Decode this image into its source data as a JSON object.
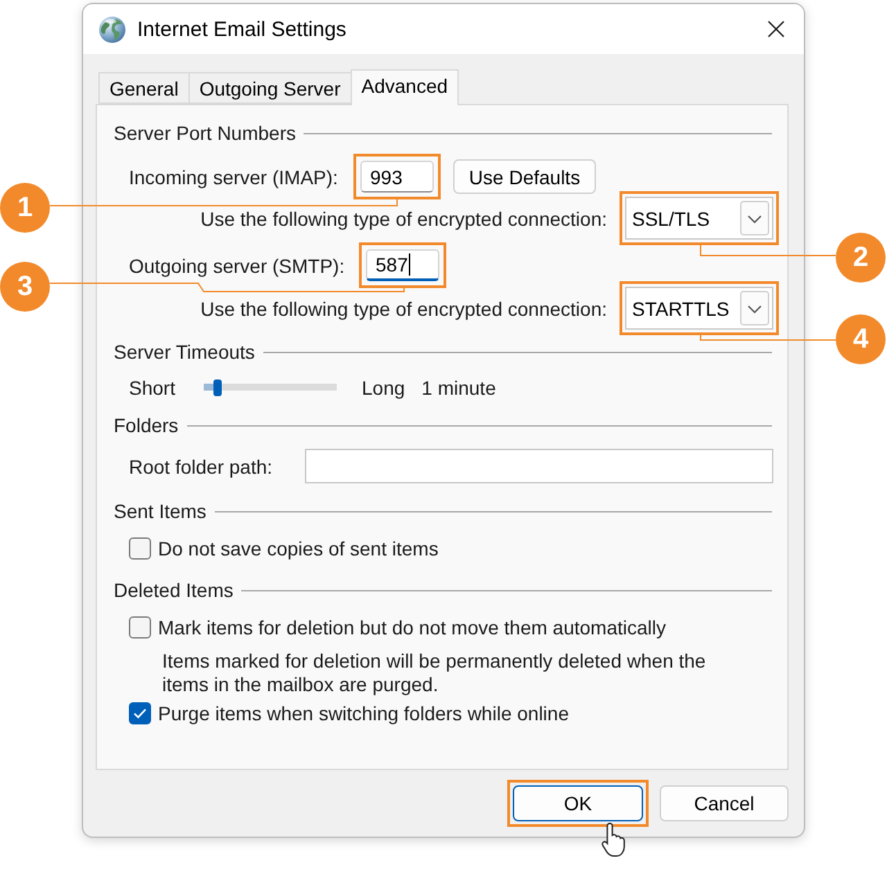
{
  "window": {
    "title": "Internet Email Settings"
  },
  "tabs": [
    {
      "label": "General",
      "selected": false
    },
    {
      "label": "Outgoing Server",
      "selected": false
    },
    {
      "label": "Advanced",
      "selected": true
    }
  ],
  "server_port_numbers": {
    "heading": "Server Port Numbers",
    "incoming": {
      "label": "Incoming server (IMAP):",
      "value": "993",
      "focused": false,
      "highlighted": true,
      "callout": "1"
    },
    "use_defaults_button": {
      "label": "Use Defaults"
    },
    "incoming_encryption": {
      "label": "Use the following type of encrypted connection:",
      "value": "SSL/TLS",
      "highlighted": true,
      "callout": "2"
    },
    "outgoing": {
      "label": "Outgoing server (SMTP):",
      "value": "587",
      "focused": true,
      "highlighted": true,
      "callout": "3"
    },
    "outgoing_encryption": {
      "label": "Use the following type of encrypted connection:",
      "value": "STARTTLS",
      "highlighted": true,
      "callout": "4"
    }
  },
  "server_timeouts": {
    "heading": "Server Timeouts",
    "min_label": "Short",
    "max_label": "Long",
    "level": 0.08,
    "reading": "1 minute"
  },
  "folders": {
    "heading": "Folders",
    "root_folder_path": {
      "label": "Root folder path:"
    }
  },
  "sent_items": {
    "heading": "Sent Items",
    "options": [
      {
        "label": "Do not save copies of sent items",
        "checked": false
      }
    ]
  },
  "deleted_items": {
    "heading": "Deleted Items",
    "options": [
      {
        "label": "Mark items for deletion but do not move them automatically",
        "checked": false,
        "note": "Items marked for deletion will be permanently deleted when the items in the mailbox are purged."
      },
      {
        "label": "Purge items when switching folders while online",
        "checked": true
      }
    ]
  },
  "buttons": [
    {
      "label": "OK",
      "default": true,
      "highlighted": true
    },
    {
      "label": "Cancel",
      "default": false,
      "highlighted": false
    }
  ]
}
